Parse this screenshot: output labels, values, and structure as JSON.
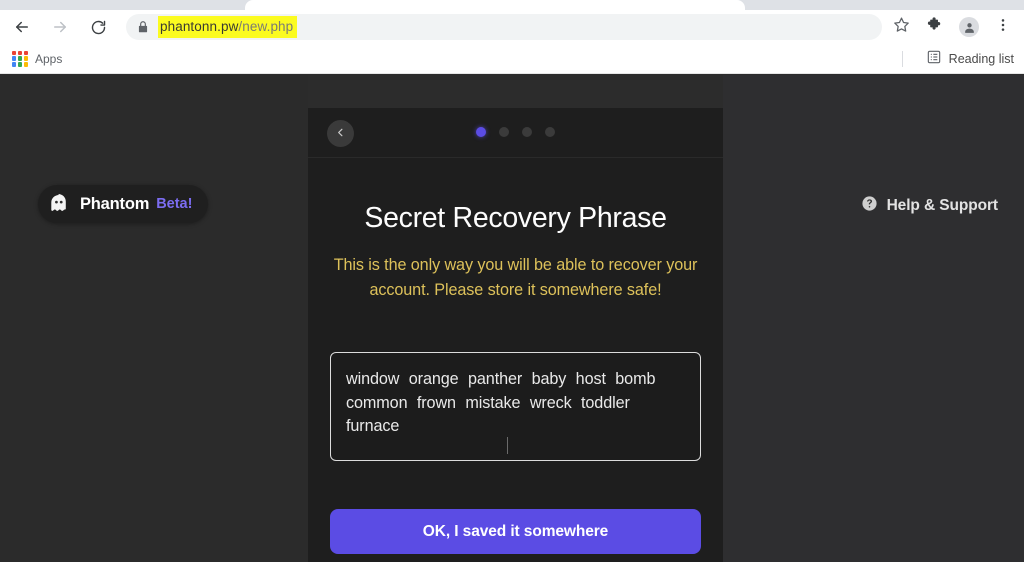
{
  "browser": {
    "nav": {
      "back_icon": "arrow-left-icon",
      "forward_icon": "arrow-right-icon",
      "reload_icon": "reload-icon"
    },
    "omnibox": {
      "lock_icon": "lock-icon",
      "url_host": "phantonn.pw",
      "url_path": "/new.php",
      "full_url": "phantonn.pw/new.php",
      "highlight_color": "#fbfb20"
    },
    "toolbar_icons": [
      {
        "name": "bookmark-star-icon",
        "label": "Bookmark this tab"
      },
      {
        "name": "extensions-puzzle-icon",
        "label": "Extensions"
      },
      {
        "name": "profile-avatar-icon",
        "label": "Profile"
      },
      {
        "name": "more-menu-icon",
        "label": "Customize and control Google Chrome"
      }
    ],
    "bookmarks_bar": {
      "apps_icon": "apps-grid-icon",
      "apps_label": "Apps",
      "reading_list_icon": "reading-list-icon",
      "reading_list_label": "Reading list"
    }
  },
  "page": {
    "brand": {
      "logo_icon": "phantom-ghost-icon",
      "name": "Phantom",
      "beta_label": "Beta!",
      "beta_color": "#7b6cf0"
    },
    "help": {
      "icon": "help-circle-icon",
      "label": "Help & Support"
    },
    "card": {
      "back_button_icon": "chevron-left-icon",
      "progress": {
        "total": 4,
        "active_index": 0,
        "active_color": "#5b4ce4",
        "inactive_color": "#3b3b3b"
      },
      "title": "Secret Recovery Phrase",
      "warning": "This is the only way you will be able to recover your account. Please store it somewhere safe!",
      "warning_color": "#ddc15a",
      "seed_phrase": {
        "words": [
          "window",
          "orange",
          "panther",
          "baby",
          "host",
          "bomb",
          "common",
          "frown",
          "mistake",
          "wreck",
          "toddler",
          "furnace"
        ],
        "word_count": 12,
        "text": "window orange panther baby host bomb common frown mistake wreck toddler furnace"
      },
      "cta_label": "OK, I saved it somewhere",
      "cta_color": "#5b4ce4"
    }
  }
}
